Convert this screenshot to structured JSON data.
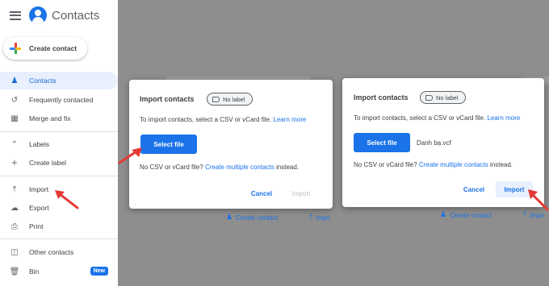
{
  "app": {
    "title": "Contacts"
  },
  "sidebar": {
    "create_label": "Create contact",
    "items": [
      {
        "label": "Contacts",
        "icon": "person-icon"
      },
      {
        "label": "Frequently contacted",
        "icon": "history-icon"
      },
      {
        "label": "Merge and fix",
        "icon": "merge-icon"
      },
      {
        "label": "Labels",
        "icon": "chevron-up-icon"
      },
      {
        "label": "Create label",
        "icon": "plus-icon"
      },
      {
        "label": "Import",
        "icon": "upload-icon"
      },
      {
        "label": "Export",
        "icon": "cloud-upload-icon"
      },
      {
        "label": "Print",
        "icon": "print-icon"
      },
      {
        "label": "Other contacts",
        "icon": "archive-icon"
      },
      {
        "label": "Bin",
        "icon": "trash-icon",
        "badge": "New"
      }
    ]
  },
  "dialog1": {
    "title": "Import contacts",
    "chip": "No label",
    "instruction": "To import contacts, select a CSV or vCard file.",
    "learn_more": "Learn more",
    "select_file": "Select file",
    "no_file_prefix": "No CSV or vCard file?",
    "create_multiple": "Create multiple contacts",
    "no_file_suffix": "instead.",
    "cancel": "Cancel",
    "import": "Import"
  },
  "dialog2": {
    "title": "Import contacts",
    "chip": "No label",
    "instruction": "To import contacts, select a CSV or vCard file.",
    "learn_more": "Learn more",
    "select_file": "Select file",
    "file_name": "Danh bạ.vcf",
    "no_file_prefix": "No CSV or vCard file?",
    "create_multiple": "Create multiple contacts",
    "no_file_suffix": "instead.",
    "cancel": "Cancel",
    "import": "Import"
  },
  "background": {
    "create_contact": "Create contact",
    "import_truncated_1": "Impo",
    "import_truncated_2": "Impo"
  },
  "colors": {
    "accent": "#1a73e8",
    "arrow": "#e53935"
  }
}
